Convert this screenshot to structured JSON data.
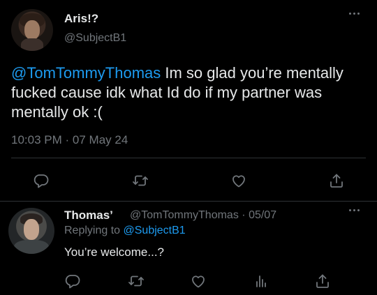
{
  "main_tweet": {
    "display_name": "Aris!?",
    "handle": "@SubjectB1",
    "mention": "@TomTommyThomas",
    "text": " Im so glad you’re mentally fucked cause idk what Id do if my partner was mentally ok :(",
    "time": "10:03 PM",
    "separator": "·",
    "date": "07 May 24"
  },
  "reply_tweet": {
    "display_name": "Thomas’",
    "handle": "@TomTommyThomas",
    "separator": "·",
    "date": "05/07",
    "replying_prefix": "Replying to ",
    "replying_to": "@SubjectB1",
    "text": "You’re welcome...?"
  },
  "icons": {
    "reply": "reply-bubble-icon",
    "retweet": "retweet-icon",
    "like": "heart-icon",
    "views": "analytics-icon",
    "share": "share-icon",
    "more": "more-dots-icon"
  },
  "colors": {
    "background": "#000000",
    "text": "#e7e9ea",
    "secondary": "#71767b",
    "accent": "#1d9bf0",
    "divider": "#2f3336"
  }
}
